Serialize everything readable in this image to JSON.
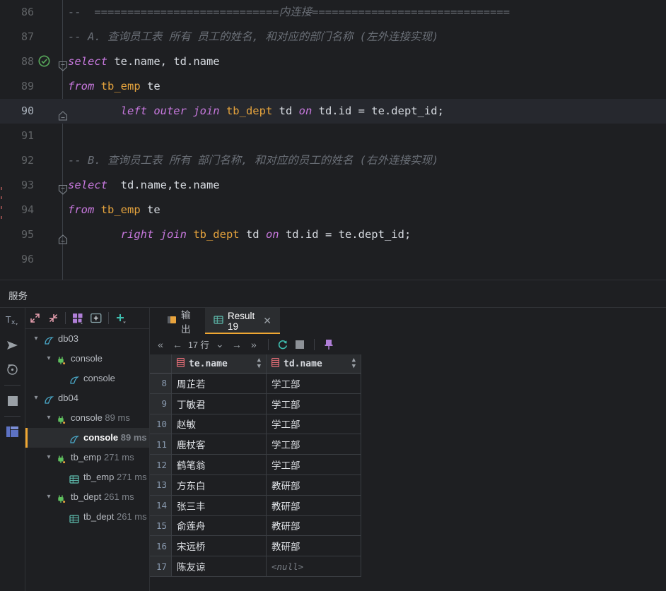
{
  "editor": {
    "lines": [
      {
        "no": "86",
        "indent": 0,
        "segments": [
          {
            "cls": "cm",
            "text": "--  ============================内连接=============================="
          }
        ]
      },
      {
        "no": "87",
        "indent": 0,
        "segments": [
          {
            "cls": "cm",
            "text": "-- A. 查询员工表 所有 员工的姓名, 和对应的部门名称 (左外连接实现)"
          }
        ]
      },
      {
        "no": "88",
        "indent": 0,
        "gutter": "run-success-check",
        "fold": "fold-collapse-top",
        "segments": [
          {
            "cls": "kw",
            "text": "select"
          },
          {
            "cls": "id",
            "text": " te.name, td.name"
          }
        ]
      },
      {
        "no": "89",
        "indent": 0,
        "segments": [
          {
            "cls": "kw",
            "text": "from"
          },
          {
            "cls": "tbl",
            "text": " tb_emp"
          },
          {
            "cls": "id",
            "text": " te"
          }
        ]
      },
      {
        "no": "90",
        "indent": 0,
        "highlight": true,
        "fold": "fold-collapse-bottom",
        "segments": [
          {
            "cls": "id",
            "text": "        "
          },
          {
            "cls": "kw",
            "text": "left outer join"
          },
          {
            "cls": "tbl",
            "text": " tb_dept"
          },
          {
            "cls": "id",
            "text": " td "
          },
          {
            "cls": "kw",
            "text": "on"
          },
          {
            "cls": "id",
            "text": " td.id = te.dept_id;"
          }
        ]
      },
      {
        "no": "91",
        "indent": 0,
        "segments": [
          {
            "cls": "id",
            "text": ""
          }
        ]
      },
      {
        "no": "92",
        "indent": 0,
        "segments": [
          {
            "cls": "cm",
            "text": "-- B. 查询员工表 所有 部门名称, 和对应的员工的姓名 (右外连接实现)"
          }
        ]
      },
      {
        "no": "93",
        "indent": 0,
        "fold": "fold-collapse-top",
        "segments": [
          {
            "cls": "kw",
            "text": "select"
          },
          {
            "cls": "id",
            "text": "  td.name,te.name"
          }
        ]
      },
      {
        "no": "94",
        "indent": 0,
        "segments": [
          {
            "cls": "kw",
            "text": "from"
          },
          {
            "cls": "tbl",
            "text": " tb_emp"
          },
          {
            "cls": "id",
            "text": " te"
          }
        ]
      },
      {
        "no": "95",
        "indent": 0,
        "fold": "fold-collapse-bottom",
        "segments": [
          {
            "cls": "id",
            "text": "        "
          },
          {
            "cls": "kw",
            "text": "right join"
          },
          {
            "cls": "tbl",
            "text": " tb_dept"
          },
          {
            "cls": "id",
            "text": " td "
          },
          {
            "cls": "kw",
            "text": "on"
          },
          {
            "cls": "id",
            "text": " td.id = te.dept_id;"
          }
        ]
      },
      {
        "no": "96",
        "indent": 0,
        "segments": [
          {
            "cls": "id",
            "text": ""
          }
        ]
      }
    ],
    "colors": {
      "comment": "#6a6f77",
      "keyword": "#c778dd",
      "table": "#e5a33d",
      "identifier": "#d6dae0",
      "background": "#1e1f22",
      "current_line": "#26282e"
    }
  },
  "services": {
    "title": "服务",
    "side_icons": [
      {
        "name": "transaction-icon",
        "glyph": "Tx"
      },
      {
        "name": "run-query-icon",
        "glyph": "send"
      },
      {
        "name": "rollback-icon",
        "glyph": "history"
      },
      {
        "name": "stop-icon",
        "glyph": "square"
      },
      {
        "name": "data-grid-icon",
        "glyph": "grid"
      }
    ],
    "toolbar": [
      {
        "name": "expand-all-button",
        "glyph": "expand"
      },
      {
        "name": "collapse-all-button",
        "glyph": "collapse"
      },
      {
        "name": "group-by-button",
        "glyph": "group"
      },
      {
        "name": "new-tab-button",
        "glyph": "newtab"
      },
      {
        "name": "add-button",
        "glyph": "plus"
      }
    ],
    "tree": [
      {
        "label": "db03",
        "ms": "",
        "depth": 0,
        "icon": "datasource-icon",
        "expanded": true,
        "selected": false
      },
      {
        "label": "console",
        "ms": "",
        "depth": 1,
        "icon": "console-plug-icon",
        "expanded": true,
        "selected": false
      },
      {
        "label": "console",
        "ms": "",
        "depth": 2,
        "icon": "datasource-icon",
        "expanded": null,
        "selected": false
      },
      {
        "label": "db04",
        "ms": "",
        "depth": 0,
        "icon": "datasource-icon",
        "expanded": true,
        "selected": false
      },
      {
        "label": "console",
        "ms": "89 ms",
        "depth": 1,
        "icon": "console-plug-icon",
        "expanded": true,
        "selected": false
      },
      {
        "label": "console",
        "ms": "89 ms",
        "depth": 2,
        "icon": "datasource-icon",
        "expanded": null,
        "selected": true
      },
      {
        "label": "tb_emp",
        "ms": "271 ms",
        "depth": 1,
        "icon": "console-plug-icon",
        "expanded": true,
        "selected": false
      },
      {
        "label": "tb_emp",
        "ms": "271 ms",
        "depth": 2,
        "icon": "table-icon",
        "expanded": null,
        "selected": false
      },
      {
        "label": "tb_dept",
        "ms": "261 ms",
        "depth": 1,
        "icon": "console-plug-icon",
        "expanded": true,
        "selected": false
      },
      {
        "label": "tb_dept",
        "ms": "261 ms",
        "depth": 2,
        "icon": "table-icon",
        "expanded": null,
        "selected": false
      }
    ]
  },
  "result": {
    "tabs": [
      {
        "label": "输出",
        "icon": "output-icon",
        "active": false,
        "closable": false
      },
      {
        "label": "Result 19",
        "icon": "table-icon",
        "active": true,
        "closable": true,
        "close": "✕"
      }
    ],
    "toolbar": {
      "first": "«",
      "prev": "←",
      "rowcount": "17 行",
      "dropdown": "⌄",
      "next": "→",
      "last": "»",
      "refresh": "refresh-icon",
      "stop": "stop-icon",
      "pin": "pin-icon"
    },
    "columns": [
      {
        "label": "te.name",
        "icon": "column-icon"
      },
      {
        "label": "td.name",
        "icon": "column-icon"
      }
    ],
    "rows": [
      {
        "n": "8",
        "c1": "周芷若",
        "c2": "学工部"
      },
      {
        "n": "9",
        "c1": "丁敏君",
        "c2": "学工部"
      },
      {
        "n": "10",
        "c1": "赵敏",
        "c2": "学工部"
      },
      {
        "n": "11",
        "c1": "鹿杖客",
        "c2": "学工部"
      },
      {
        "n": "12",
        "c1": "鹤笔翁",
        "c2": "学工部"
      },
      {
        "n": "13",
        "c1": "方东白",
        "c2": "教研部"
      },
      {
        "n": "14",
        "c1": "张三丰",
        "c2": "教研部"
      },
      {
        "n": "15",
        "c1": "俞莲舟",
        "c2": "教研部"
      },
      {
        "n": "16",
        "c1": "宋远桥",
        "c2": "教研部"
      },
      {
        "n": "17",
        "c1": "陈友谅",
        "c2": "<null>",
        "c2_null": true
      }
    ]
  }
}
